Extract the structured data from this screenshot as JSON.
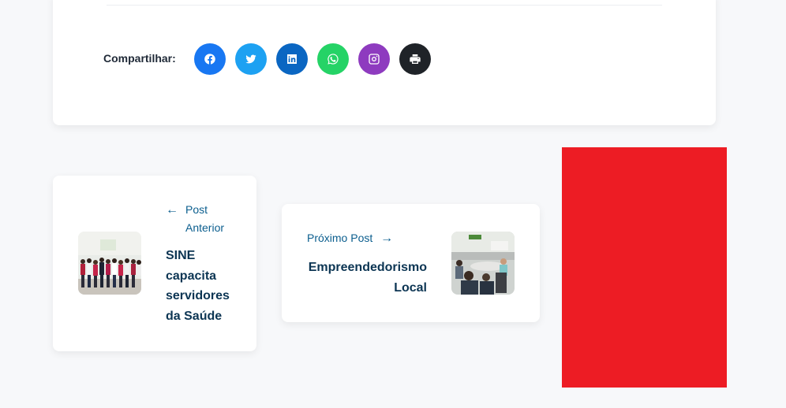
{
  "share": {
    "label": "Compartilhar:",
    "buttons": [
      {
        "name": "facebook",
        "icon": "facebook-icon",
        "color": "#1877f2"
      },
      {
        "name": "twitter",
        "icon": "twitter-icon",
        "color": "#1da1f2"
      },
      {
        "name": "linkedin",
        "icon": "linkedin-icon",
        "color": "#0a66c2"
      },
      {
        "name": "whatsapp",
        "icon": "whatsapp-icon",
        "color": "#25d366"
      },
      {
        "name": "instagram",
        "icon": "instagram-icon",
        "color": "#8e3bbf"
      },
      {
        "name": "print",
        "icon": "print-icon",
        "color": "#1f2328"
      }
    ]
  },
  "post_nav": {
    "previous": {
      "kicker": "Post Anterior",
      "arrow": "←",
      "title": "SINE capacita servidores da Saúde"
    },
    "next": {
      "kicker": "Próximo Post",
      "arrow": "→",
      "title": "Empreendedorismo Local"
    }
  },
  "colors": {
    "accent": "#0b5e8e",
    "title": "#0c3553",
    "ad": "#ed1c24"
  }
}
